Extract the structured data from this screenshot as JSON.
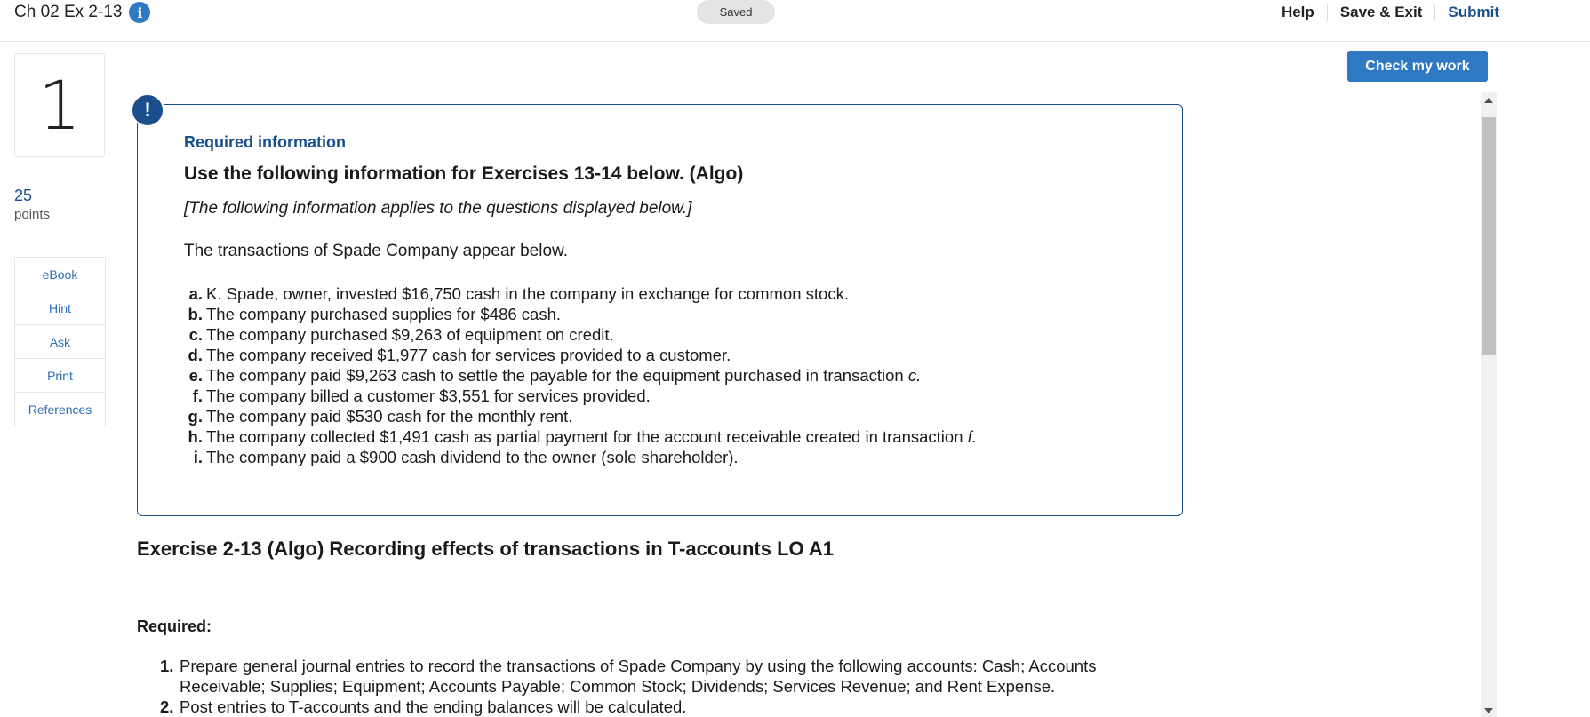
{
  "header": {
    "title": "Ch 02 Ex 2-13",
    "saved_label": "Saved",
    "nav": {
      "help": "Help",
      "save_exit": "Save & Exit",
      "submit": "Submit"
    }
  },
  "question": {
    "number": "1",
    "points_value": "25",
    "points_label": "points"
  },
  "tools": [
    "eBook",
    "Hint",
    "Ask",
    "Print",
    "References"
  ],
  "check_button": "Check my work",
  "info_box": {
    "alert_symbol": "!",
    "heading": "Required information",
    "subheading": "Use the following information for Exercises 13-14 below. (Algo)",
    "applies_note": "[The following information applies to the questions displayed below.]",
    "intro": "The transactions of Spade Company appear below.",
    "transactions": [
      {
        "letter": "a.",
        "text": "K. Spade, owner, invested $16,750 cash in the company in exchange for common stock.",
        "ref": ""
      },
      {
        "letter": "b.",
        "text": "The company purchased supplies for $486 cash.",
        "ref": ""
      },
      {
        "letter": "c.",
        "text": "The company purchased $9,263 of equipment on credit.",
        "ref": ""
      },
      {
        "letter": "d.",
        "text": "The company received $1,977 cash for services provided to a customer.",
        "ref": ""
      },
      {
        "letter": "e.",
        "text": "The company paid $9,263 cash to settle the payable for the equipment purchased in transaction ",
        "ref": "c."
      },
      {
        "letter": "f.",
        "text": "The company billed a customer $3,551 for services provided.",
        "ref": ""
      },
      {
        "letter": "g.",
        "text": "The company paid $530 cash for the monthly rent.",
        "ref": ""
      },
      {
        "letter": "h.",
        "text": "The company collected $1,491 cash as partial payment for the account receivable created in transaction ",
        "ref": "f."
      },
      {
        "letter": "i.",
        "text": "The company paid a $900 cash dividend to the owner (sole shareholder).",
        "ref": ""
      }
    ]
  },
  "exercise": {
    "title": "Exercise 2-13 (Algo) Recording effects of transactions in T-accounts LO A1",
    "required_label": "Required:",
    "requirements": [
      {
        "num": "1.",
        "text": "Prepare general journal entries to record the transactions of Spade Company by using the following accounts: Cash; Accounts Receivable; Supplies; Equipment; Accounts Payable; Common Stock; Dividends; Services Revenue; and Rent Expense."
      },
      {
        "num": "2.",
        "text": "Post entries to T-accounts and the ending balances will be calculated."
      }
    ]
  }
}
